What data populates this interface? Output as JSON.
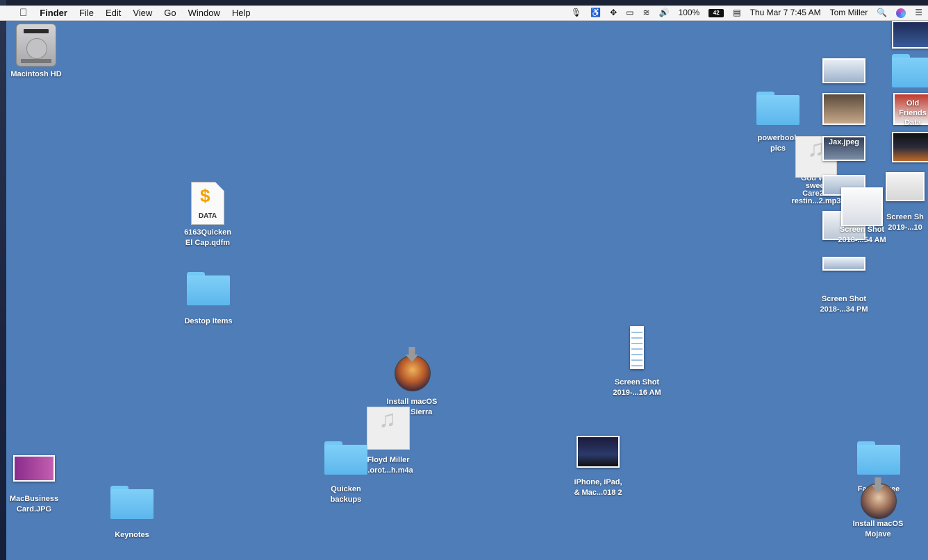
{
  "menubar": {
    "app_name": "Finder",
    "menus": [
      "File",
      "Edit",
      "View",
      "Go",
      "Window",
      "Help"
    ],
    "battery_percent": "100%",
    "battery_badge": "42",
    "datetime": "Thu Mar 7  7:45 AM",
    "user": "Tom Miller"
  },
  "icons": {
    "macintosh_hd": "Macintosh HD",
    "quicken_file": "6163Quicken\nEl Cap.qdfm",
    "quicken_tag": "DATA",
    "destop_items": "Destop Items",
    "install_high_sierra": "Install macOS\nHigh Sierra",
    "floyd_miller": "Floyd Miller\n...orot...h.m4a",
    "quicken_backups": "Quicken\nbackups",
    "iphone_ipad": "iPhone, iPad,\n& Mac...018 2",
    "screenshot_16am": "Screen Shot\n2019-...16 AM",
    "macbusiness_card": "MacBusiness\nCard.JPG",
    "keynotes": "Keynotes",
    "family_tree_maker": "Family Tree\nMaker",
    "install_mojave": "Install macOS\nMojave",
    "powerbook_pics": "powerbook\npics",
    "god_w": "God W...\nsweet\nCare2...\nrestin...2.mp3",
    "jax_jpeg": "Jax.jpeg",
    "screenshot_54am": "Screen Shot\n2018-...54 AM",
    "screenshot_34pm": "Screen Shot\n2018-...34 PM",
    "screenshot_10": "Screen Sh\n2019-...10",
    "old_friends_data": "Old Friends\nData"
  }
}
